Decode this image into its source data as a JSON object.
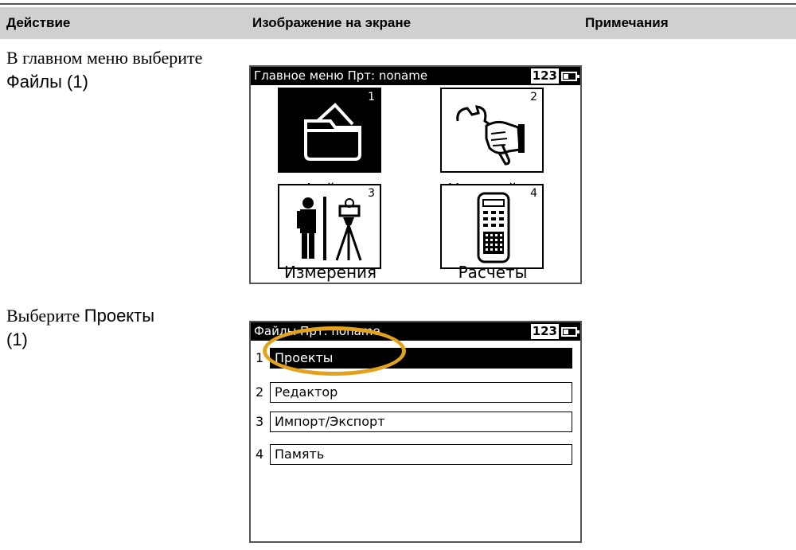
{
  "table_header": {
    "col1": "Действие",
    "col2": "Изображение на экране",
    "col3": "Примечания"
  },
  "step1": {
    "instruction_prefix": "В главном меню выберите ",
    "instruction_keyword": "Файлы (1)",
    "screen": {
      "title": "Главное меню  Прт: noname",
      "keyboard_mode": "123",
      "tiles": [
        {
          "number": "1",
          "label": "Файлы",
          "icon": "folder-icon",
          "selected": true
        },
        {
          "number": "2",
          "label": "Настройки",
          "icon": "wrench-hand-icon",
          "selected": false
        },
        {
          "number": "3",
          "label": "Измерения",
          "icon": "surveyor-tripod-icon",
          "selected": false
        },
        {
          "number": "4",
          "label": "Расчеты",
          "icon": "calculator-icon",
          "selected": false
        }
      ]
    }
  },
  "step2": {
    "instruction_prefix": "Выберите ",
    "instruction_keyword": "Проекты",
    "instruction_suffix": "(1)",
    "screen": {
      "title": "Файлы  Прт: noname",
      "keyboard_mode": "123",
      "items": [
        {
          "number": "1",
          "label": "Проекты",
          "selected": true
        },
        {
          "number": "2",
          "label": "Редактор",
          "selected": false
        },
        {
          "number": "3",
          "label": "Импорт/Экспорт",
          "selected": false
        },
        {
          "number": "4",
          "label": "Память",
          "selected": false
        }
      ],
      "highlight_color": "#e2a21d"
    }
  }
}
